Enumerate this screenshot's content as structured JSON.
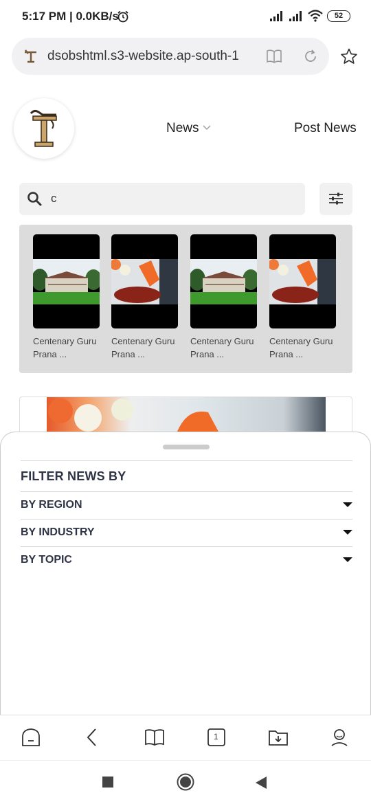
{
  "status_bar": {
    "time": "5:17 PM | 0.0KB/s",
    "battery": "52"
  },
  "browser": {
    "url": "dsobshtml.s3-website.ap-south-1"
  },
  "header": {
    "nav_news": "News",
    "nav_post_news": "Post News"
  },
  "search": {
    "value": "c"
  },
  "carousel": {
    "items": [
      {
        "caption_line1": "Centenary Guru",
        "caption_line2": "Prana ...",
        "image": "building-lawn"
      },
      {
        "caption_line1": "Centenary Guru",
        "caption_line2": "Prana ...",
        "image": "flowers-orange-cup"
      },
      {
        "caption_line1": "Centenary Guru",
        "caption_line2": "Prana ...",
        "image": "building-lawn"
      },
      {
        "caption_line1": "Centenary Guru",
        "caption_line2": "Prana ...",
        "image": "flowers-orange-cup"
      }
    ]
  },
  "filter_sheet": {
    "title": "FILTER NEWS BY",
    "options": [
      {
        "label": "BY REGION"
      },
      {
        "label": "BY INDUSTRY"
      },
      {
        "label": "BY TOPIC"
      }
    ]
  },
  "toolbar": {
    "tab_count": "1"
  },
  "colors": {
    "sheet_text": "#2e3445",
    "carousel_bg": "#dcdcdc",
    "search_bg": "#f1f1f1"
  }
}
